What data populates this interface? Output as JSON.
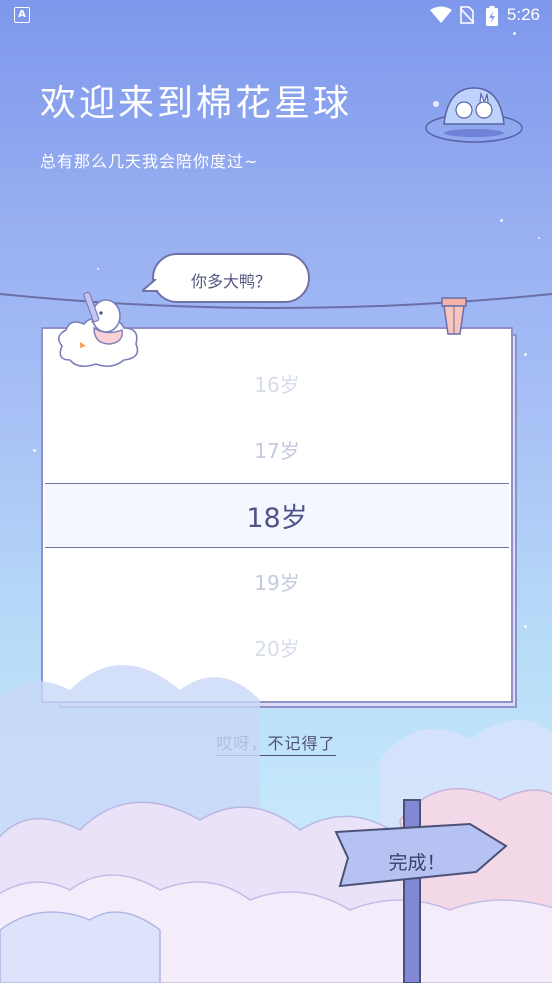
{
  "status_bar": {
    "time": "5:26",
    "left_badge": "A"
  },
  "header": {
    "title": "欢迎来到棉花星球",
    "subtitle": "总有那么几天我会陪你度过~"
  },
  "bubble": {
    "text": "你多大鸭？"
  },
  "picker": {
    "options": [
      "16岁",
      "17岁",
      "18岁",
      "19岁",
      "20岁"
    ],
    "selected": "18岁"
  },
  "forget_link": "哎呀，不记得了",
  "done_sign": "完成！",
  "colors": {
    "sky_top": "#7d97ec",
    "sky_bottom": "#c3e6fb",
    "card_border": "#8f92c9",
    "text_dark": "#4c5178"
  }
}
